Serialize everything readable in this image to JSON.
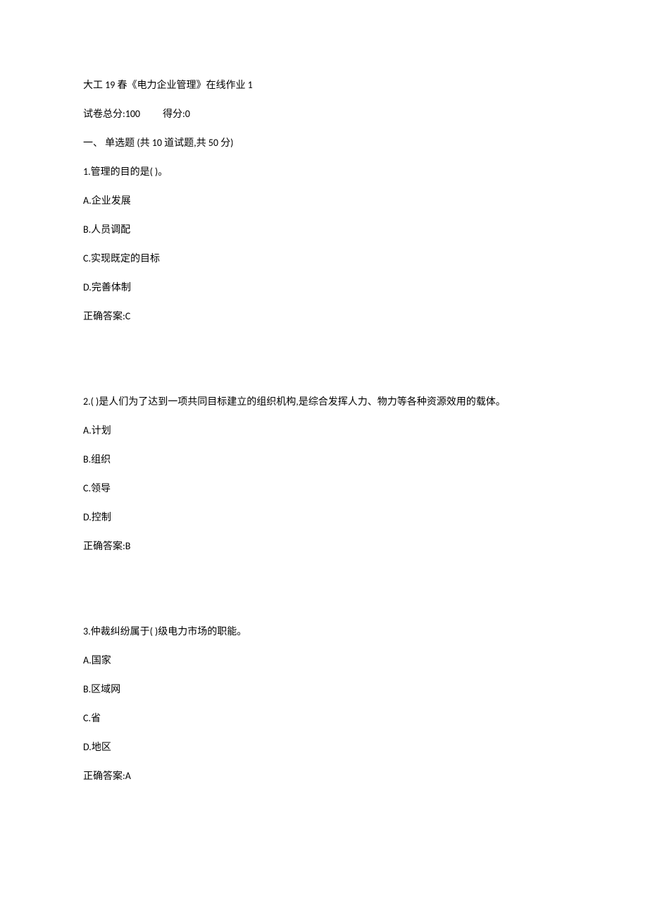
{
  "header": {
    "title": "大工 19 春《电力企业管理》在线作业 1",
    "score_total_label": "试卷总分:100",
    "score_get_label": "得分:0",
    "section_header": "一、 单选题 (共 10 道试题,共 50 分)"
  },
  "questions": [
    {
      "stem": "1.管理的目的是( )。",
      "options": [
        "A.企业发展",
        "B.人员调配",
        "C.实现既定的目标",
        "D.完善体制"
      ],
      "answer": "正确答案:C"
    },
    {
      "stem": "2.( )是人们为了达到一项共同目标建立的组织机构,是综合发挥人力、物力等各种资源效用的载体。",
      "options": [
        "A.计划",
        "B.组织",
        "C.领导",
        "D.控制"
      ],
      "answer": "正确答案:B"
    },
    {
      "stem": "3.仲裁纠纷属于( )级电力市场的职能。",
      "options": [
        "A.国家",
        "B.区域网",
        "C.省",
        "D.地区"
      ],
      "answer": "正确答案:A"
    }
  ]
}
